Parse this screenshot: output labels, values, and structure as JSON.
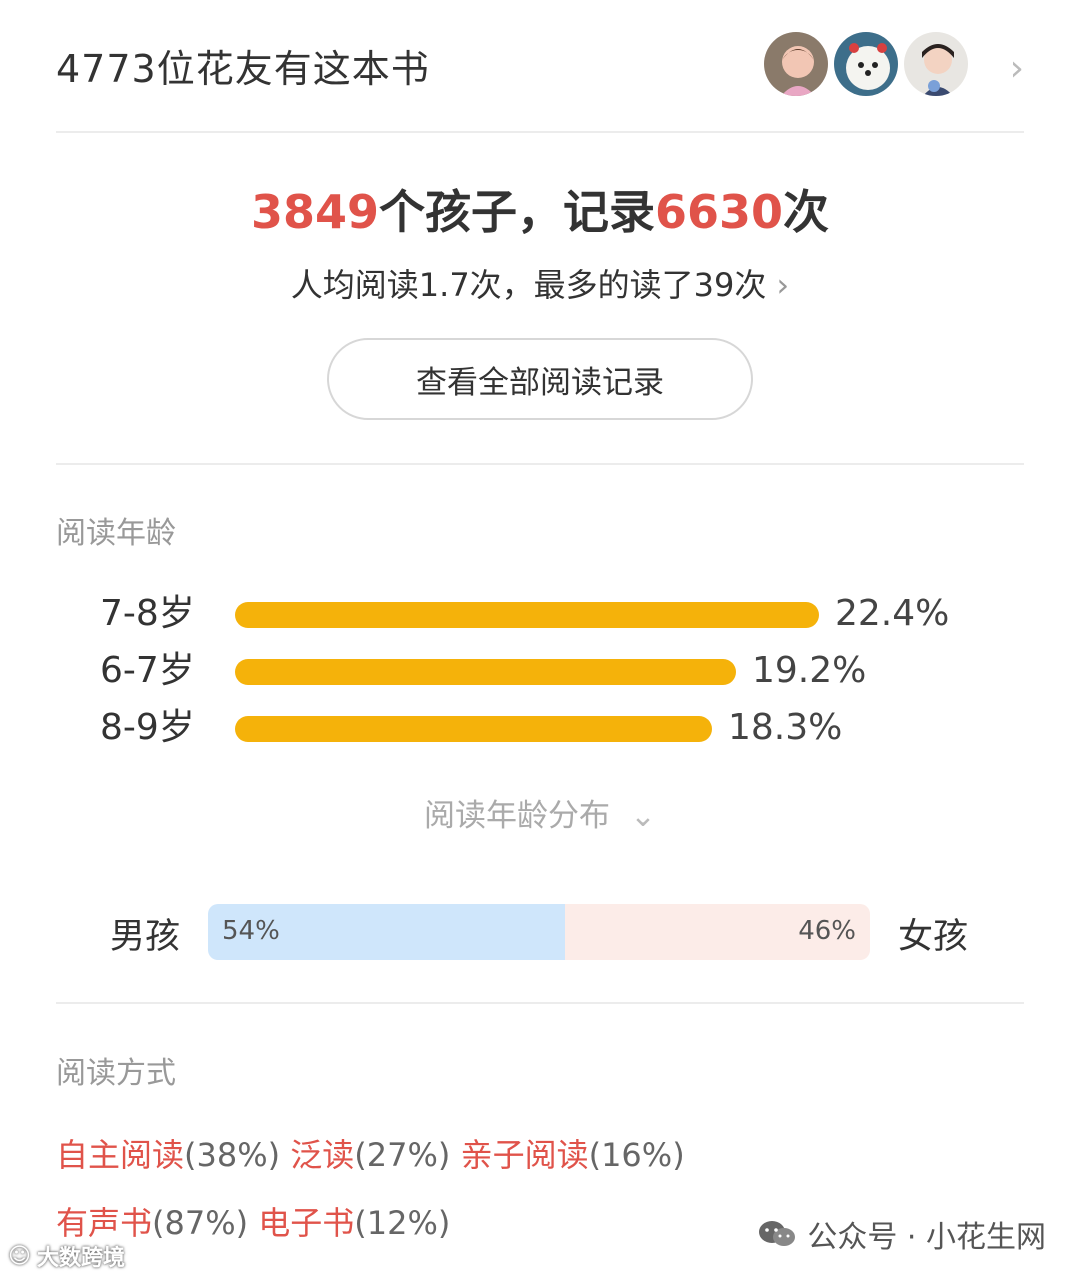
{
  "header": {
    "title": "4773位花友有这本书",
    "chevron": "›"
  },
  "stats": {
    "kids_count": "3849",
    "kids_suffix": "个孩子，记录",
    "record_count": "6630",
    "record_suffix": "次",
    "sub_text": "人均阅读1.7次，最多的读了39次",
    "sub_chevron": "›",
    "view_all": "查看全部阅读记录"
  },
  "age": {
    "label": "阅读年龄",
    "bars": [
      {
        "label": "7-8岁",
        "value": 22.4,
        "pct": "22.4%"
      },
      {
        "label": "6-7岁",
        "value": 19.2,
        "pct": "19.2%"
      },
      {
        "label": "8-9岁",
        "value": 18.3,
        "pct": "18.3%"
      }
    ],
    "distribution_label": "阅读年龄分布",
    "distribution_chevron": "⌄",
    "bar_color": "#f5b20a"
  },
  "gender": {
    "boy_label": "男孩",
    "girl_label": "女孩",
    "boy_pct": "54%",
    "girl_pct": "46%",
    "boy_fraction": 0.54,
    "boy_color": "#cfe6fb",
    "girl_color": "#fcece8"
  },
  "reading_mode": {
    "label": "阅读方式",
    "line1": [
      {
        "name": "自主阅读",
        "pct": "(38%)"
      },
      {
        "name": "泛读",
        "pct": "(27%)"
      },
      {
        "name": "亲子阅读",
        "pct": "(16%)"
      }
    ],
    "line2": [
      {
        "name": "有声书",
        "pct": "(87%)"
      },
      {
        "name": "电子书",
        "pct": "(12%)"
      }
    ],
    "accent_color": "#e0534a"
  },
  "watermarks": {
    "right": "公众号 · 小花生网",
    "left": "大数跨境"
  }
}
